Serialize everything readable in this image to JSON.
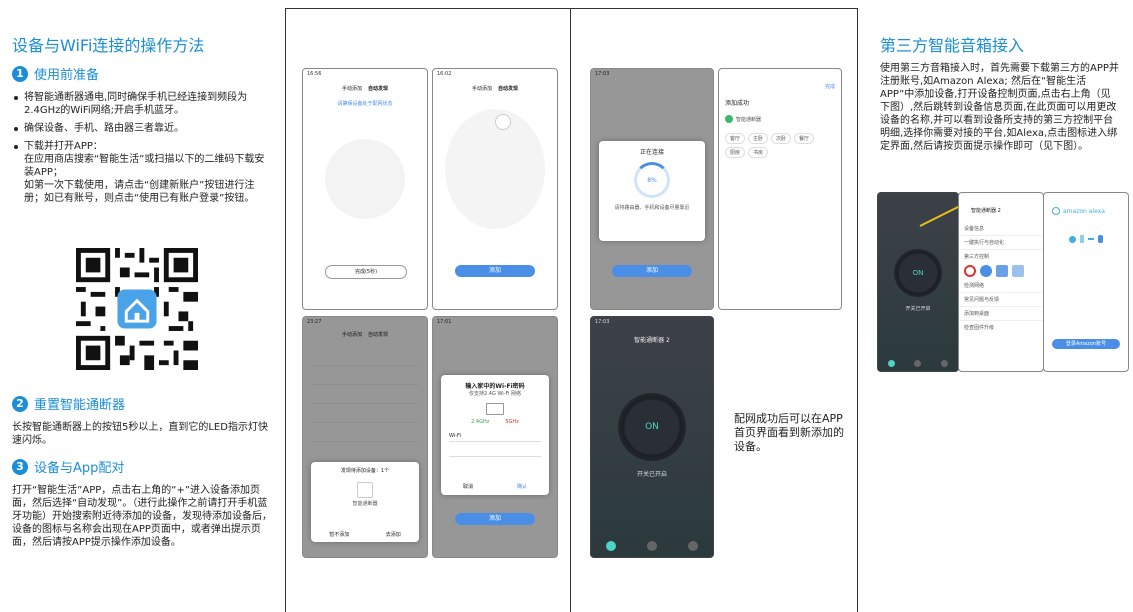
{
  "left": {
    "title": "设备与WiFi连接的操作方法",
    "step1": {
      "num": "1",
      "title": "使用前准备"
    },
    "bullets": [
      "将智能通断器通电,同时确保手机已经连接到频段为2.4GHz的WiFi网络;开启手机蓝牙。",
      "确保设备、手机、路由器三者靠近。",
      "下载并打开APP：\n在应用商店搜索“智能生活”或扫描以下的二维码下载安装APP；\n如第一次下载使用，请点击“创建新账户”按钮进行注册；如已有账号，则点击“使用已有账户登录”按钮。"
    ],
    "step2": {
      "num": "2",
      "title": "重置智能通断器"
    },
    "step2_text": "长按智能通断器上的按钮5秒以上，直到它的LED指示灯快速闪烁。",
    "step3": {
      "num": "3",
      "title": "设备与App配对"
    },
    "step3_text": "打开“智能生活”APP，点击右上角的“+”进入设备添加页面，然后选择“自动发现”。（进行此操作之前请打开手机蓝牙功能）开始搜索附近待添加的设备，发现待添加设备后，设备的图标与名称会出现在APP页面中，或者弹出提示页面，然后请按APP提示操作添加设备。"
  },
  "col2": {
    "phone1": {
      "time": "16:56",
      "tab1": "手动添加",
      "tab2": "自动发现",
      "hint": "请确保设备处于配网状态",
      "button": "完成(5秒)"
    },
    "phone2": {
      "time": "16:02",
      "tab1": "手动添加",
      "tab2": "自动发现",
      "button": "添加"
    },
    "phone3": {
      "time": "23:27",
      "tab1": "手动添加",
      "tab2": "自动发现",
      "popup_title": "发现待添加设备：1个",
      "popup_item": "智能通断器",
      "cancel": "暂不添加",
      "go": "去添加"
    },
    "phone4": {
      "time": "17:01",
      "popup_title": "输入家中的Wi-Fi密码",
      "popup_sub": "仅支持2.4G Wi-Fi 网络",
      "ghz1": "2.4GHz",
      "ghz2": "5GHz",
      "wifi_label": "Wi-Fi",
      "cancel": "取消",
      "next": "确认",
      "button": "添加"
    }
  },
  "col3": {
    "phone5": {
      "time": "17:03",
      "modal_title": "正在连接",
      "percent": "8%",
      "modal_text": "请将路由器、手机和设备尽量靠近",
      "button": "添加"
    },
    "phone6": {
      "title": "添加成功",
      "device": "智能通断器",
      "done": "完成",
      "rooms": [
        "客厅",
        "主卧",
        "次卧",
        "餐厅",
        "厨房",
        "书房"
      ]
    },
    "phone7": {
      "time": "17:03",
      "title": "智能通断器 2",
      "on": "ON",
      "status": "开关已开启"
    },
    "caption": "配网成功后可以在APP首页界面看到新添加的设备。"
  },
  "col4": {
    "title": "第三方智能音箱接入",
    "text": "使用第三方音箱接入时，首先需要下载第三方的APP并注册账号,如Amazon Alexa; 然后在“智能生活APP”中添加设备,打开设备控制页面,点击右上角（见下图）,然后跳转到设备信息页面,在此页面可以用更改设备的名称,并可以看到设备所支持的第三方控制平台明细,选择你需要对接的平台,如Alexa,点击图标进入绑定界面,然后请按页面提示操作即可（见下图）。",
    "phoneA": {
      "on": "ON",
      "status": "开关已开启"
    },
    "phoneB": {
      "title": "智能通断器 2",
      "rows": [
        "设备信息",
        "一键执行与自动化",
        "第三方控制",
        "检测网络",
        "常见问题与反馈",
        "添加到桌面",
        "检查固件升级"
      ]
    },
    "phoneC": {
      "brand": "amazon alexa",
      "button": "登录Amazon账号"
    }
  }
}
